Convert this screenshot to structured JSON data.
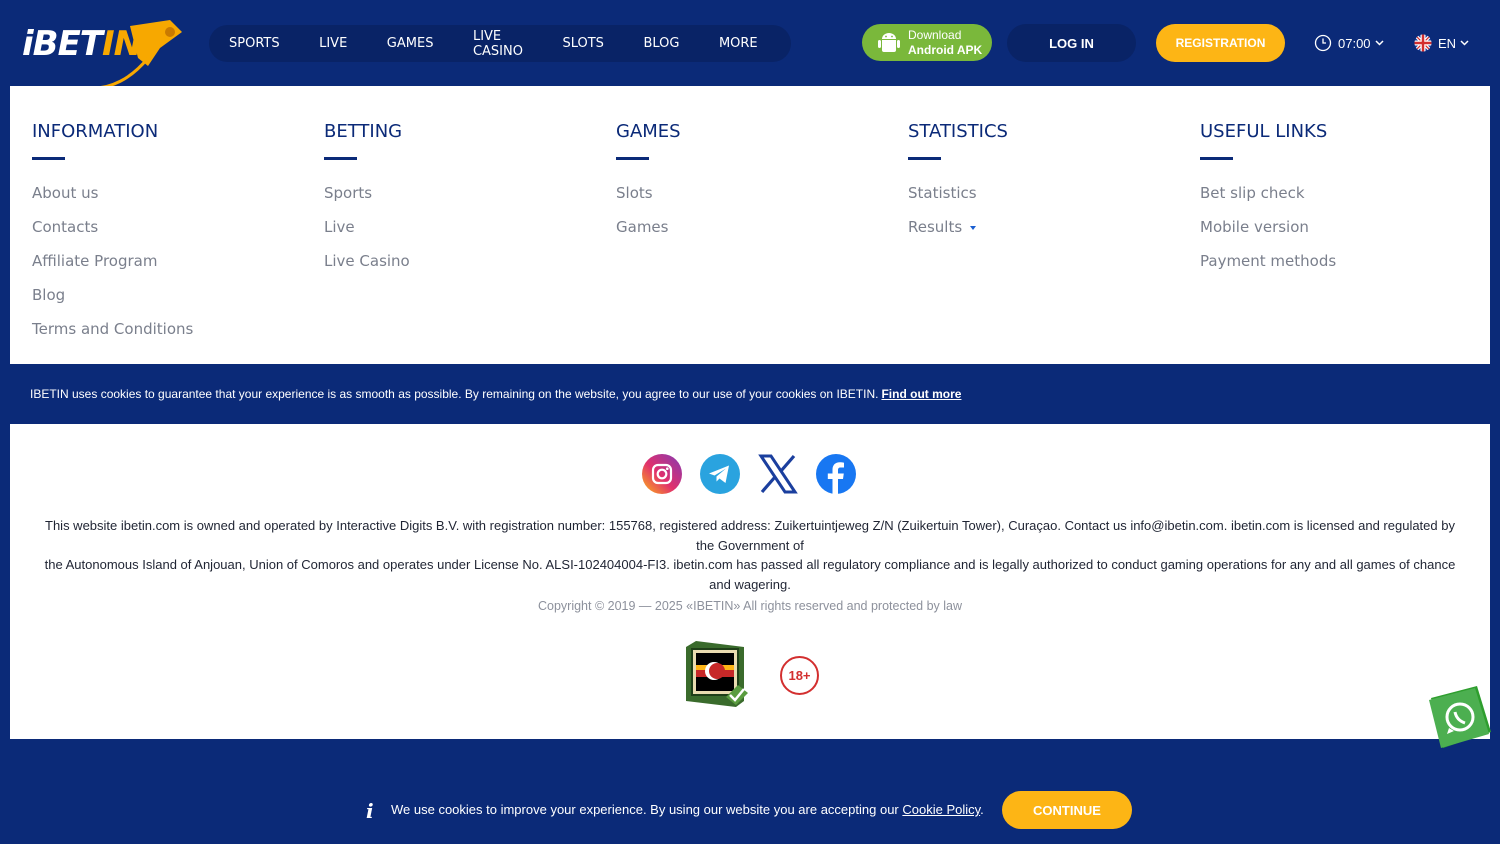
{
  "brand": {
    "logo_main": "iBET",
    "logo_accent": "IN"
  },
  "nav": {
    "items": [
      "SPORTS",
      "LIVE",
      "GAMES",
      "LIVE CASINO",
      "SLOTS",
      "BLOG",
      "MORE"
    ]
  },
  "header": {
    "apk_line1": "Download",
    "apk_line2": "Android APK",
    "login_label": "LOG IN",
    "register_label": "REGISTRATION",
    "time": "07:00",
    "language": "EN"
  },
  "columns": [
    {
      "title": "INFORMATION",
      "links": [
        "About us",
        "Contacts",
        "Affiliate Program",
        "Blog",
        "Terms and Conditions"
      ]
    },
    {
      "title": "BETTING",
      "links": [
        "Sports",
        "Live",
        "Live Casino"
      ]
    },
    {
      "title": "GAMES",
      "links": [
        "Slots",
        "Games"
      ]
    },
    {
      "title": "STATISTICS",
      "links": [
        "Statistics",
        "Results"
      ]
    },
    {
      "title": "USEFUL LINKS",
      "links": [
        "Bet slip check",
        "Mobile version",
        "Payment methods"
      ]
    }
  ],
  "cookie_strip": {
    "text": "IBETIN uses cookies to guarantee that your experience is as smooth as possible. By remaining on the website, you agree to our use of your cookies on IBETIN.",
    "link": "Find out more"
  },
  "footer": {
    "legal_line1": "This website ibetin.com is owned and operated by Interactive Digits B.V. with registration number: 155768, registered address: Zuikertuintjeweg Z/N (Zuikertuin Tower), Curaçao. Contact us info@ibetin.com. ibetin.com is licensed and regulated by the Government of",
    "legal_line2": "the Autonomous Island of Anjouan, Union of Comoros and operates under License No. ALSI-102404004-FI3. ibetin.com has passed all regulatory compliance and is legally authorized to conduct gaming operations for any and all games of chance and wagering.",
    "copyright": "Copyright © 2019 — 2025 «IBETIN» All rights reserved and protected by law",
    "age_badge": "18+"
  },
  "bottom_cookie": {
    "icon": "i",
    "text": "We use cookies to improve your experience. By using our website you are accepting our",
    "link": "Cookie Policy",
    "suffix": ".",
    "continue_label": "CONTINUE"
  },
  "colors": {
    "background": "#0b2a78",
    "accent_yellow": "#fdb515",
    "apk_green": "#7ab83b",
    "nav_dark": "#092366"
  }
}
